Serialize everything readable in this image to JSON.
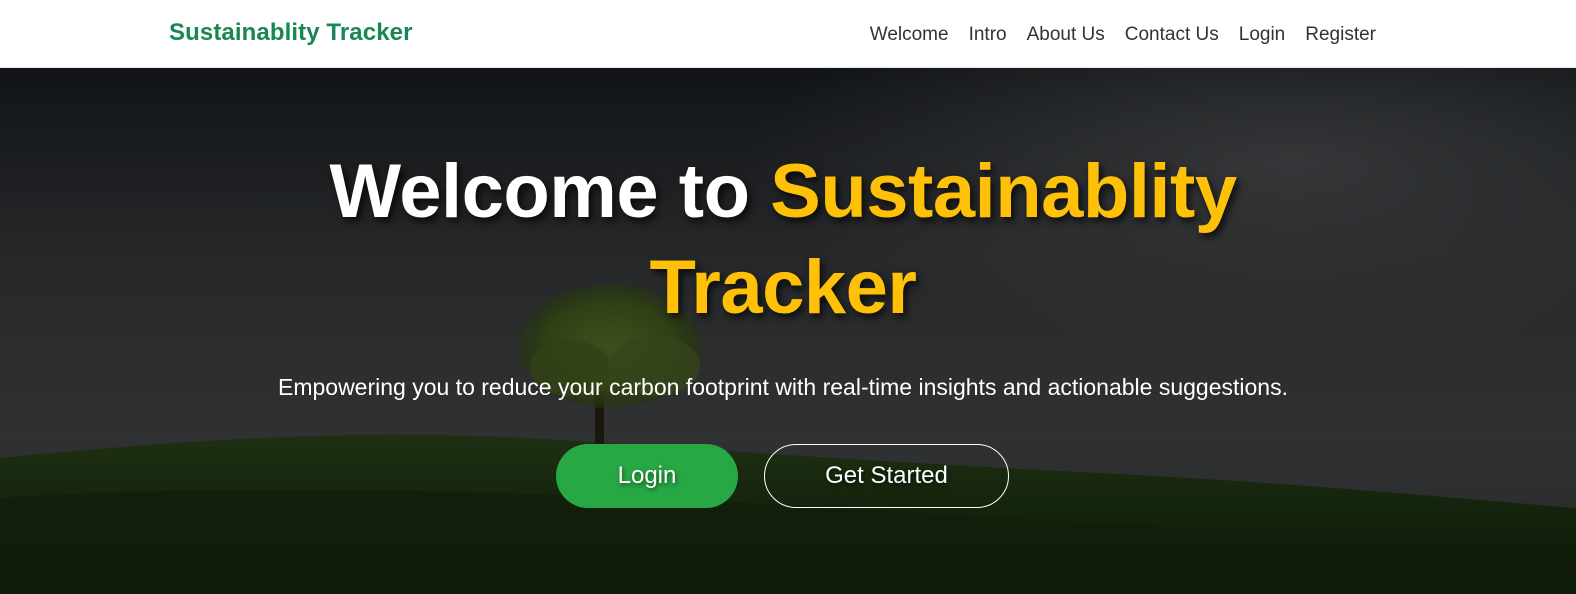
{
  "navbar": {
    "brand": "Sustainablity Tracker",
    "links": [
      "Welcome",
      "Intro",
      "About Us",
      "Contact Us",
      "Login",
      "Register"
    ]
  },
  "hero": {
    "title_prefix": "Welcome to ",
    "title_accent": "Sustainablity Tracker",
    "subtitle": "Empowering you to reduce your carbon footprint with real-time insights and actionable suggestions.",
    "login_button": "Login",
    "get_started_button": "Get Started"
  },
  "colors": {
    "brand_green": "#198754",
    "accent_yellow": "#ffc107",
    "button_green": "#28a745"
  }
}
